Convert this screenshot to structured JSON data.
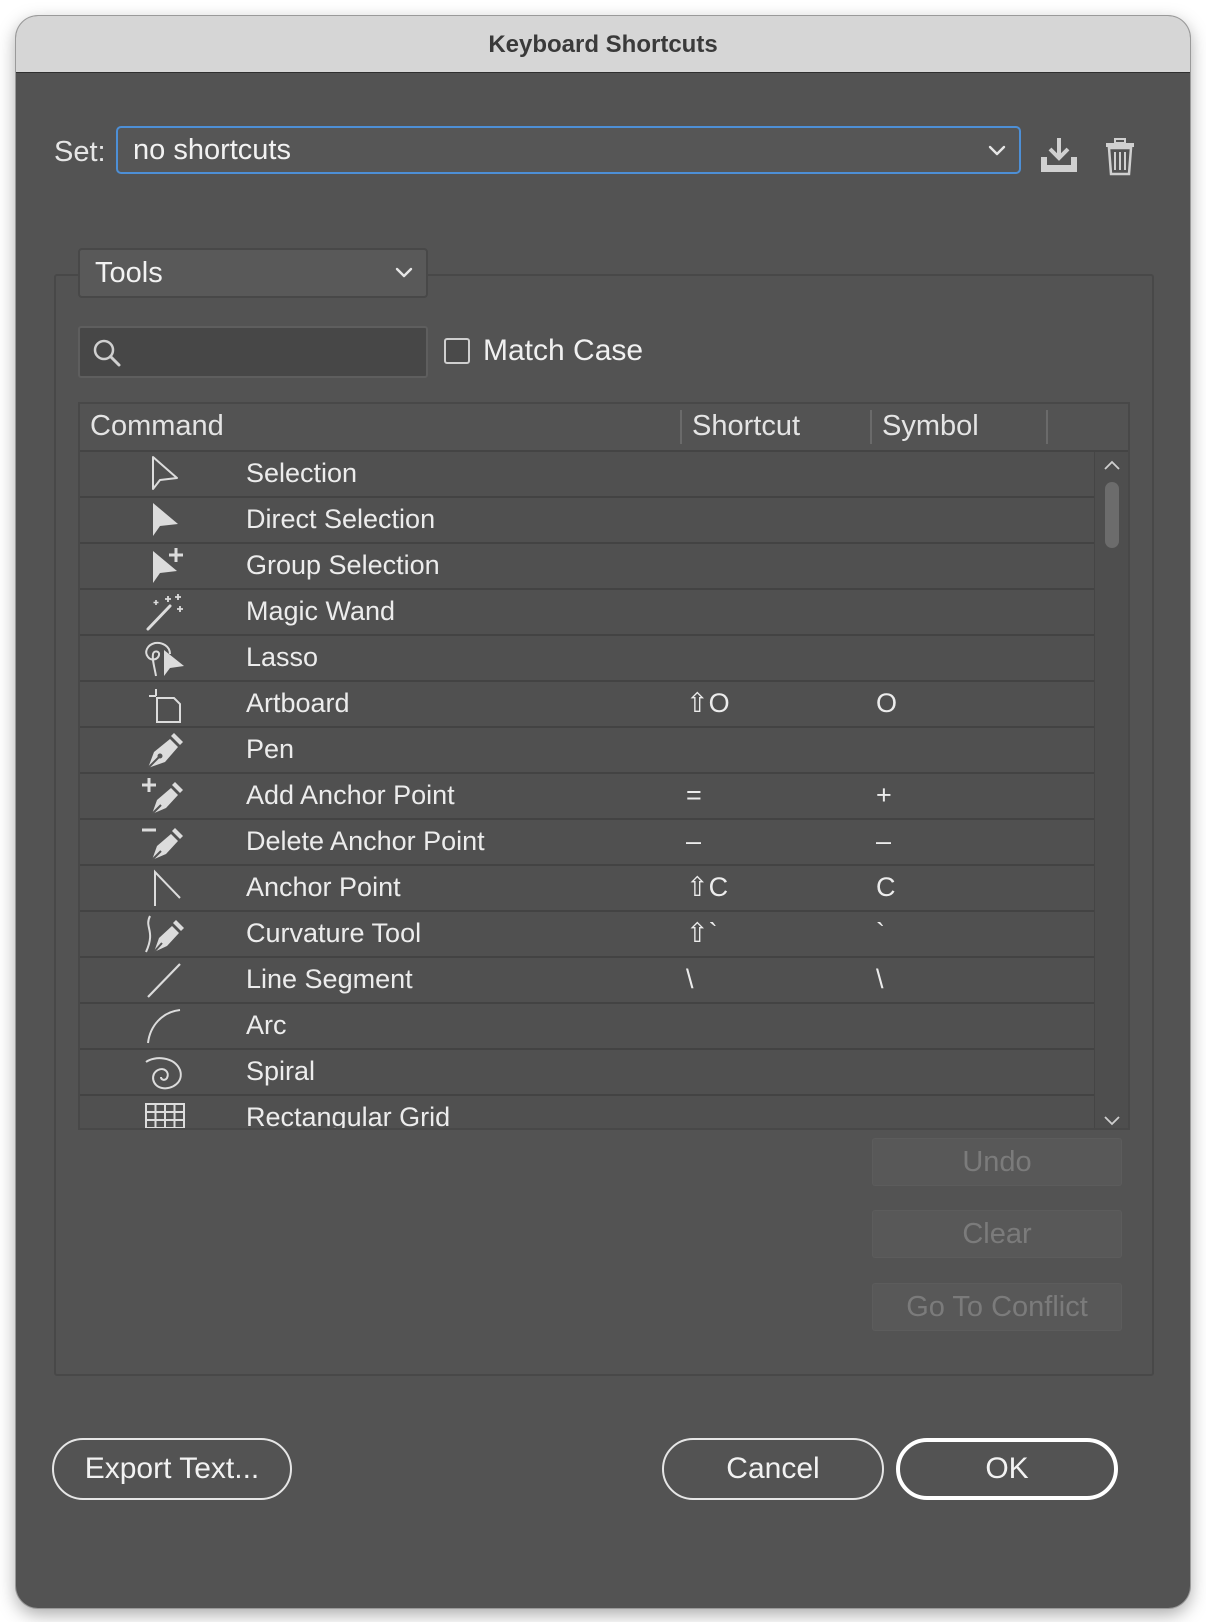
{
  "window": {
    "title": "Keyboard Shortcuts"
  },
  "set": {
    "label": "Set:",
    "value": "no shortcuts"
  },
  "category": {
    "value": "Tools"
  },
  "search": {
    "placeholder": "",
    "value": ""
  },
  "match_case": {
    "label": "Match Case",
    "checked": false
  },
  "table": {
    "columns": [
      "Command",
      "Shortcut",
      "Symbol"
    ],
    "rows": [
      {
        "icon": "selection-arrow-icon",
        "command": "Selection",
        "shortcut": "",
        "symbol": ""
      },
      {
        "icon": "direct-selection-arrow-icon",
        "command": "Direct Selection",
        "shortcut": "",
        "symbol": ""
      },
      {
        "icon": "group-selection-icon",
        "command": "Group Selection",
        "shortcut": "",
        "symbol": ""
      },
      {
        "icon": "magic-wand-icon",
        "command": "Magic Wand",
        "shortcut": "",
        "symbol": ""
      },
      {
        "icon": "lasso-icon",
        "command": "Lasso",
        "shortcut": "",
        "symbol": ""
      },
      {
        "icon": "artboard-icon",
        "command": "Artboard",
        "shortcut": "⇧O",
        "symbol": "O"
      },
      {
        "icon": "pen-icon",
        "command": "Pen",
        "shortcut": "",
        "symbol": ""
      },
      {
        "icon": "add-anchor-point-icon",
        "command": "Add Anchor Point",
        "shortcut": "=",
        "symbol": "+"
      },
      {
        "icon": "delete-anchor-point-icon",
        "command": "Delete Anchor Point",
        "shortcut": "–",
        "symbol": "–"
      },
      {
        "icon": "anchor-point-icon",
        "command": "Anchor Point",
        "shortcut": "⇧C",
        "symbol": "C"
      },
      {
        "icon": "curvature-tool-icon",
        "command": "Curvature Tool",
        "shortcut": "⇧`",
        "symbol": "`"
      },
      {
        "icon": "line-segment-icon",
        "command": "Line Segment",
        "shortcut": "\\",
        "symbol": "\\"
      },
      {
        "icon": "arc-icon",
        "command": "Arc",
        "shortcut": "",
        "symbol": ""
      },
      {
        "icon": "spiral-icon",
        "command": "Spiral",
        "shortcut": "",
        "symbol": ""
      },
      {
        "icon": "rectangular-grid-icon",
        "command": "Rectangular Grid",
        "shortcut": "",
        "symbol": ""
      }
    ]
  },
  "buttons": {
    "undo": "Undo",
    "clear": "Clear",
    "go_to_conflict": "Go To Conflict",
    "export_text": "Export Text...",
    "cancel": "Cancel",
    "ok": "OK"
  },
  "colors": {
    "dialog_bg": "#535353",
    "title_bar": "#d6d6d6",
    "focus_ring": "#4d8fd6",
    "disabled_text": "#7b7b7b"
  }
}
